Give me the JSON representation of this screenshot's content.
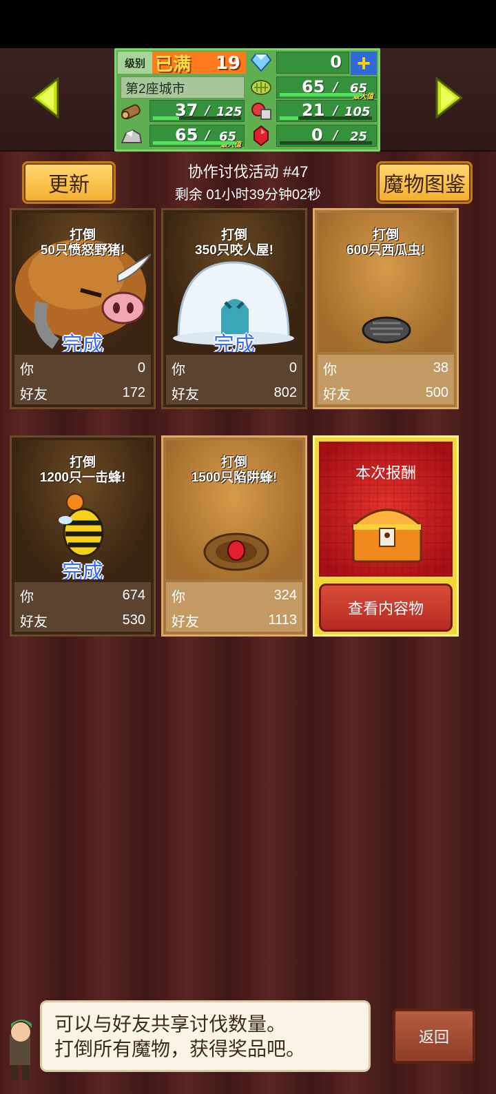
{
  "hud": {
    "level_label": "级别",
    "level_max_text": "已满",
    "level_value": "19",
    "gems": "0",
    "city_name": "第2座城市",
    "grass": {
      "current": "65",
      "cap": "65",
      "note": "最大值",
      "fill": 1.0
    },
    "wood": {
      "current": "37",
      "cap": "125",
      "fill": 0.3
    },
    "food": {
      "current": "21",
      "cap": "105",
      "fill": 0.2
    },
    "ore": {
      "current": "65",
      "cap": "65",
      "note": "最大值",
      "fill": 1.0
    },
    "ruby": {
      "current": "0",
      "cap": "25",
      "fill": 0.0
    },
    "separator": "/"
  },
  "actions": {
    "refresh": "更新",
    "atlas": "魔物图鉴"
  },
  "event": {
    "title": "协作讨伐活动 #47",
    "timer": "剩余 01小时39分钟02秒"
  },
  "labels": {
    "you": "你",
    "friends": "好友",
    "done": "完成"
  },
  "cards": [
    {
      "task": "打倒\n50只愤怒野猪!",
      "you": "0",
      "friends": "172",
      "done": true,
      "monster": "boar-icon"
    },
    {
      "task": "打倒\n350只咬人屋!",
      "you": "0",
      "friends": "802",
      "done": true,
      "monster": "snow-ghost-icon"
    },
    {
      "task": "打倒\n600只西瓜虫!",
      "you": "38",
      "friends": "500",
      "done": false,
      "monster": "pillbug-icon"
    },
    {
      "task": "打倒\n1200只一击蜂!",
      "you": "674",
      "friends": "530",
      "done": true,
      "monster": "bee-icon"
    },
    {
      "task": "打倒\n1500只陷阱蜂!",
      "you": "324",
      "friends": "1113",
      "done": false,
      "monster": "antlion-icon"
    }
  ],
  "reward": {
    "title": "本次报酬",
    "button": "查看内容物"
  },
  "dialog": {
    "line1": "可以与好友共享讨伐数量。",
    "line2": "打倒所有魔物，获得奖品吧。"
  },
  "back": "返回",
  "colors": {
    "accent_yellow": "#f3ae2c",
    "done_blue": "#3a6bff",
    "hud_green": "#36913c"
  }
}
